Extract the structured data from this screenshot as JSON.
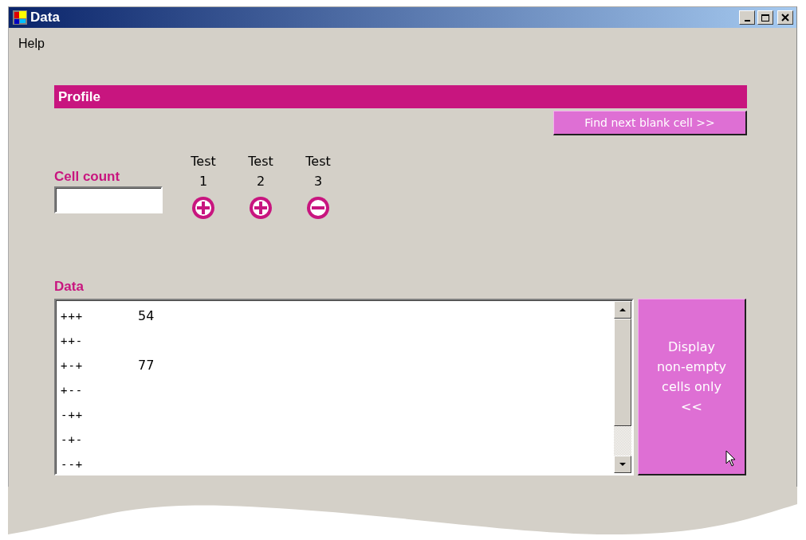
{
  "window": {
    "title": "Data"
  },
  "menu": [
    "Help"
  ],
  "profile": {
    "title": "Profile",
    "find_button": "Find next blank cell >>"
  },
  "cell_count": {
    "label": "Cell count"
  },
  "tests": [
    {
      "label": "Test",
      "number": "1",
      "kind": "plus"
    },
    {
      "label": "Test",
      "number": "2",
      "kind": "plus"
    },
    {
      "label": "Test",
      "number": "3",
      "kind": "minus"
    }
  ],
  "data": {
    "label": "Data",
    "rows": [
      {
        "pattern": "+++",
        "value": "54"
      },
      {
        "pattern": "++-"
      },
      {
        "pattern": "+-+",
        "value": "77"
      },
      {
        "pattern": "+--"
      },
      {
        "pattern": "-++"
      },
      {
        "pattern": "-+-"
      },
      {
        "pattern": "--+"
      }
    ],
    "display_button": "Display\nnon-empty\ncells only\n<<"
  }
}
